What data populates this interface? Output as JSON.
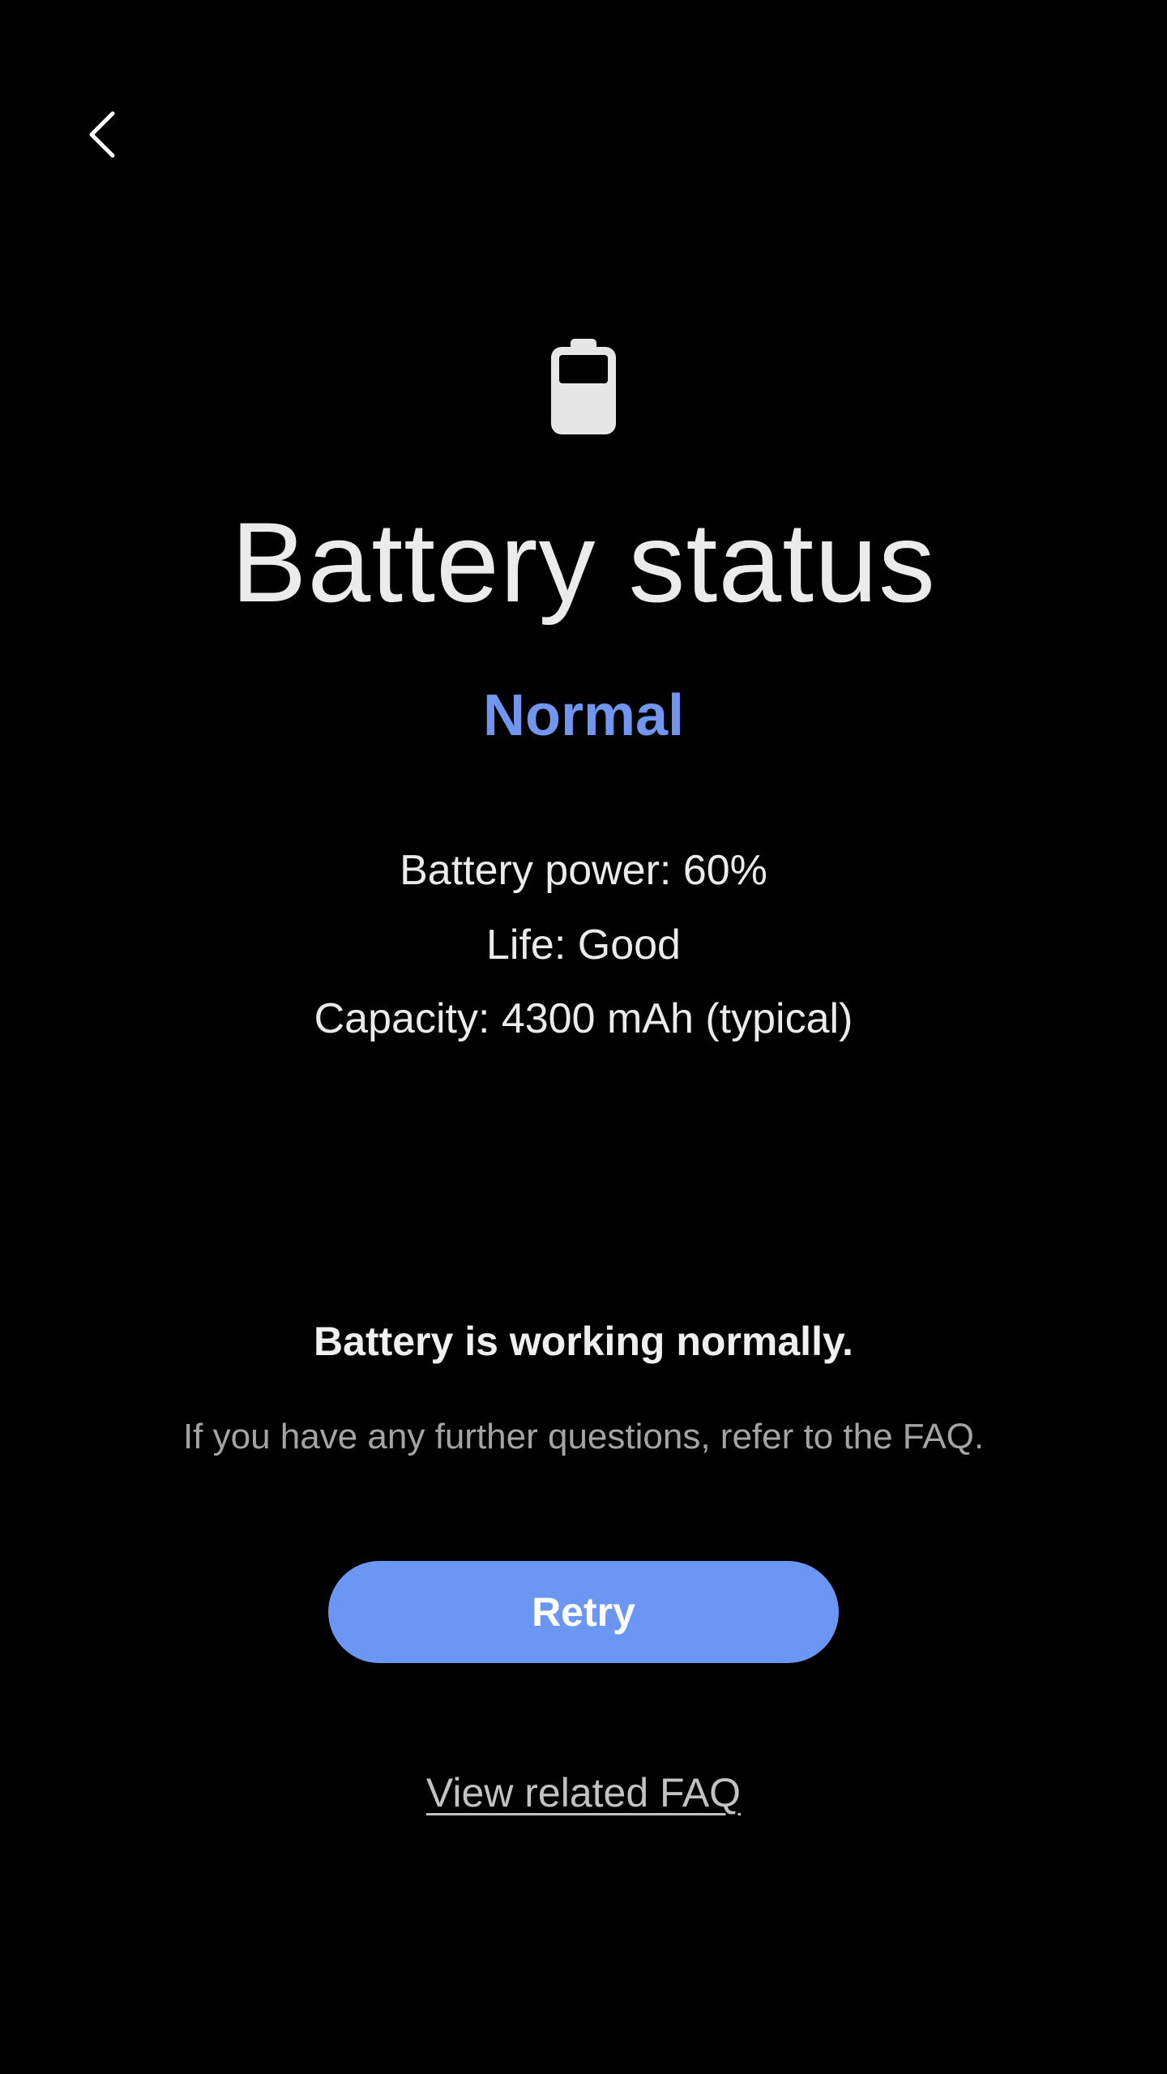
{
  "header": {
    "back_icon": "chevron-left-icon"
  },
  "hero": {
    "icon": "battery-icon",
    "battery_level": 0.6,
    "title": "Battery status",
    "status": "Normal"
  },
  "details": {
    "power": "Battery power: 60%",
    "life": "Life: Good",
    "capacity": "Capacity: 4300 mAh (typical)"
  },
  "message": {
    "heading": "Battery is working normally.",
    "body": "If you have any further questions, refer to the FAQ."
  },
  "actions": {
    "retry_label": "Retry",
    "faq_link_label": "View related FAQ"
  },
  "colors": {
    "accent": "#7096f0",
    "accent_button": "#6c96f4",
    "background": "#000000",
    "icon": "#e6e6e6"
  }
}
